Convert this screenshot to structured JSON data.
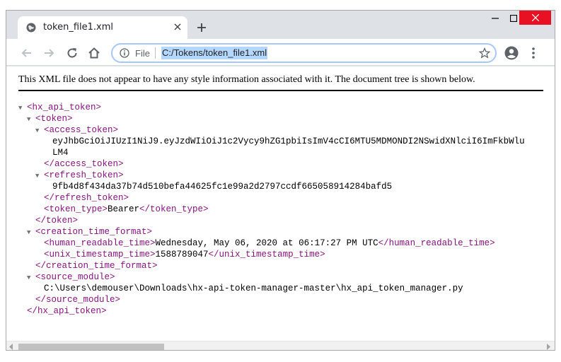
{
  "tab": {
    "title": "token_file1.xml",
    "icon": "globe-icon"
  },
  "toolbar": {
    "file_label": "File",
    "url": "C:/Tokens/token_file1.xml"
  },
  "notice": "This XML file does not appear to have any style information associated with it. The document tree is shown below.",
  "tree": {
    "l1": "<hx_api_token>",
    "l2": "<token>",
    "l3": "<access_token>",
    "l4": "eyJhbGciOiJIUzI1NiJ9.eyJzdWIiOiJ1c2Vycy9hZG1pbiIsImV4cCI6MTU5MDMONDI2NSwidXNlciI6ImFkbWlu",
    "l5": "LM4",
    "l6": "</access_token>",
    "l7": "<refresh_token>",
    "l8": "9fb4d8f434da37b74d510befa44625fc1e99a2d2797ccdf665058914284bafd5",
    "l9": "</refresh_token>",
    "l10_open": "<token_type>",
    "l10_val": "Bearer",
    "l10_close": "</token_type>",
    "l11": "</token>",
    "l12": "<creation_time_format>",
    "l13_open": "<human_readable_time>",
    "l13_val": "Wednesday, May 06, 2020 at 06:17:27 PM UTC",
    "l13_close": "</human_readable_time>",
    "l14_open": "<unix_timestamp_time>",
    "l14_val": "1588789047",
    "l14_close": "</unix_timestamp_time>",
    "l15": "</creation_time_format>",
    "l16": "<source_module>",
    "l17": "C:\\Users\\demouser\\Downloads\\hx-api-token-manager-master\\hx_api_token_manager.py",
    "l18": "</source_module>",
    "l19": "</hx_api_token>"
  },
  "colors": {
    "tag": "#881280",
    "url_highlight": "#b3d7ff",
    "close_button": "#e81123"
  }
}
